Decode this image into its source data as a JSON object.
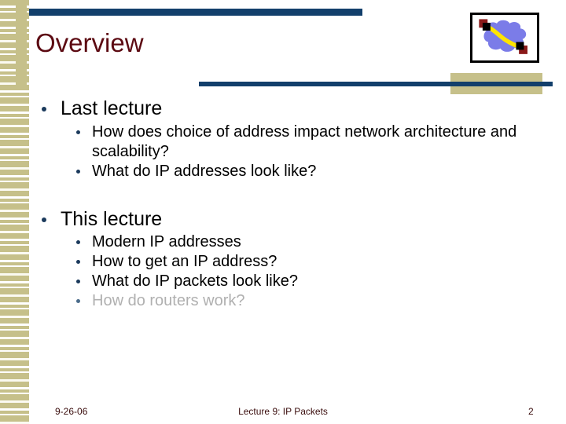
{
  "slide": {
    "title": "Overview",
    "theme": {
      "navy": "#123f6b",
      "tan": "#c6c08a",
      "title_maroon": "#5c0a12",
      "bullet_navy": "#1b3a5c",
      "dim_gray": "#b0b0b0",
      "background": "#ffffff"
    }
  },
  "logo": {
    "name": "network-cloud-logo",
    "cloud_color": "#7b7ce8",
    "link_color": "#ffe400",
    "node_color": "#000000",
    "node_accent_color": "#8b1a1a",
    "border_color": "#000000"
  },
  "content": {
    "sections": [
      {
        "heading": "Last lecture",
        "items": [
          {
            "text": "How does choice of address impact network architecture and scalability?",
            "dim": false
          },
          {
            "text": "What do IP addresses look like?",
            "dim": false
          }
        ]
      },
      {
        "heading": "This lecture",
        "items": [
          {
            "text": "Modern IP addresses",
            "dim": false
          },
          {
            "text": "How to get an IP address?",
            "dim": false
          },
          {
            "text": "What do IP packets look like?",
            "dim": false
          },
          {
            "text": "How do routers work?",
            "dim": true
          }
        ]
      }
    ]
  },
  "footer": {
    "date": "9-26-06",
    "center": "Lecture 9: IP Packets",
    "page_number": "2"
  }
}
